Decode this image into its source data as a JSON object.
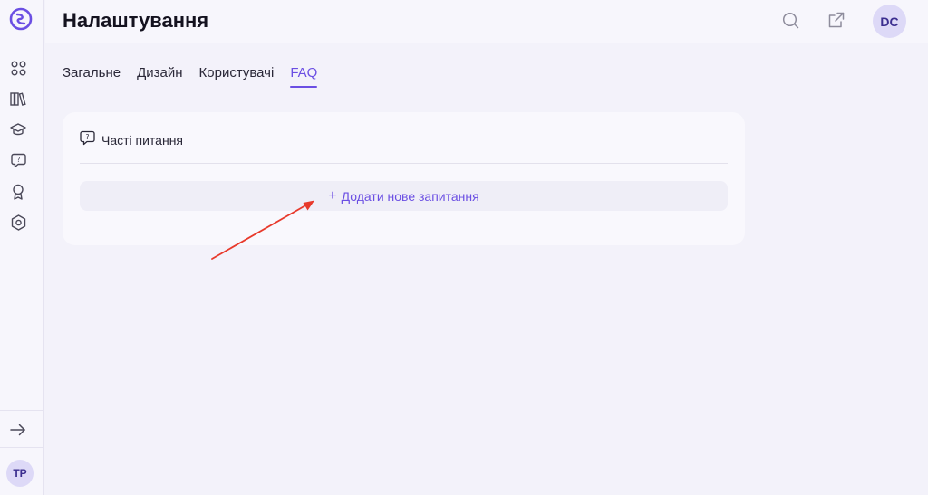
{
  "sidebar": {
    "avatar_initials": "TP",
    "nav_icons": [
      "apps-icon",
      "library-icon",
      "graduation-cap-icon",
      "faq-chat-icon",
      "award-icon",
      "settings-hex-icon"
    ],
    "collapse_icon": "arrow-right-icon"
  },
  "header": {
    "title": "Налаштування",
    "avatar_initials": "DC",
    "icons": [
      "search-icon",
      "external-link-icon"
    ]
  },
  "tabs": [
    {
      "label": "Загальне",
      "active": false
    },
    {
      "label": "Дизайн",
      "active": false
    },
    {
      "label": "Користувачі",
      "active": false
    },
    {
      "label": "FAQ",
      "active": true
    }
  ],
  "faq": {
    "section_title": "Часті питання",
    "add_button_label": "Додати нове запитання"
  },
  "colors": {
    "accent": "#6b4fe3",
    "background": "#f3f2fa",
    "annotation_arrow": "#e8392b"
  }
}
